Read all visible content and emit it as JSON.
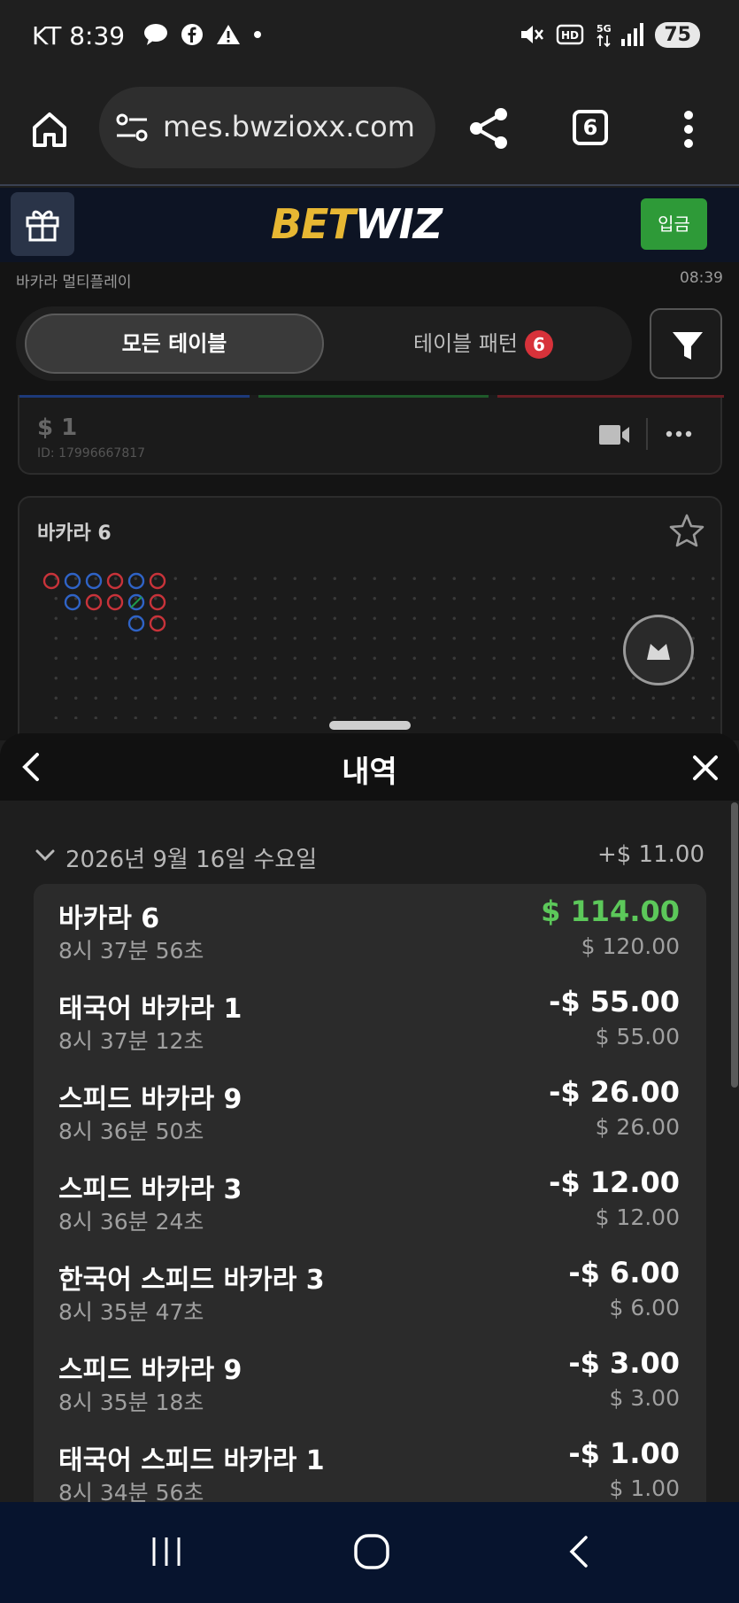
{
  "status_bar": {
    "carrier_time": "KT 8:39",
    "battery": "75"
  },
  "browser": {
    "url": "mes.bwzioxx.com",
    "tab_count": "6"
  },
  "site": {
    "logo_bet": "BET",
    "logo_wiz": "WIZ",
    "deposit_label": "입금"
  },
  "lobby": {
    "title": "바카라 멀티플레이",
    "time": "08:39",
    "tab_all": "모든 테이블",
    "tab_pattern": "테이블 패턴",
    "pattern_badge": "6",
    "card1": {
      "amount": "$ 1",
      "id": "ID: 17996667817"
    },
    "card2": {
      "title": "바카라 6"
    }
  },
  "history": {
    "title": "내역",
    "date": "2026년 9월 16일 수요일",
    "day_total": "+$ 11.00",
    "rows": [
      {
        "game": "바카라 6",
        "time": "8시 37분 56초",
        "result": "$ 114.00",
        "stake": "$ 120.00"
      },
      {
        "game": "태국어 바카라 1",
        "time": "8시 37분 12초",
        "result": "-$ 55.00",
        "stake": "$ 55.00"
      },
      {
        "game": "스피드 바카라 9",
        "time": "8시 36분 50초",
        "result": "-$ 26.00",
        "stake": "$ 26.00"
      },
      {
        "game": "스피드 바카라 3",
        "time": "8시 36분 24초",
        "result": "-$ 12.00",
        "stake": "$ 12.00"
      },
      {
        "game": "한국어 스피드 바카라 3",
        "time": "8시 35분 47초",
        "result": "-$ 6.00",
        "stake": "$ 6.00"
      },
      {
        "game": "스피드 바카라 9",
        "time": "8시 35분 18초",
        "result": "-$ 3.00",
        "stake": "$ 3.00"
      },
      {
        "game": "태국어 스피드 바카라 1",
        "time": "8시 34분 56초",
        "result": "-$ 1.00",
        "stake": "$ 1.00"
      }
    ]
  },
  "colors": {
    "win": "#5cc85a",
    "deposit": "#2e9a38",
    "logo_gold": "#e7b733",
    "badge_red": "#d7323a"
  }
}
